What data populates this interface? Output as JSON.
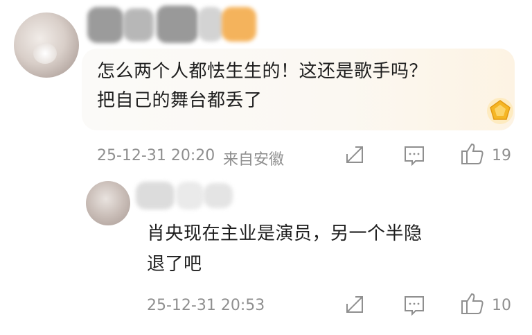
{
  "comment": {
    "text_line1": "怎么两个人都怯生生的！这还是歌手吗？",
    "text_line2": "把自己的舞台都丢了",
    "timestamp": "25-12-31 20:20",
    "location": "来自安徽",
    "like_count": "19"
  },
  "reply": {
    "text_line1": "肖央现在主业是演员，另一个半隐",
    "text_line2": "退了吧",
    "timestamp": "25-12-31 20:53",
    "like_count": "10"
  },
  "colors": {
    "text": "#1e1e1e",
    "meta": "#8f8f8f",
    "badge": "#f5b625"
  },
  "icons": [
    "share-icon",
    "comment-icon",
    "like-icon",
    "vip-badge-icon"
  ]
}
